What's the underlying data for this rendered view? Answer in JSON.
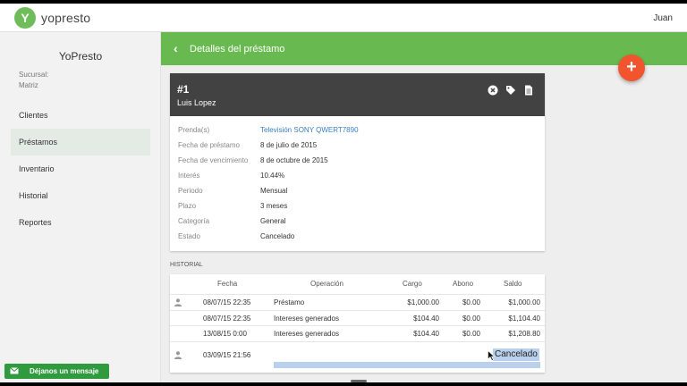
{
  "app": {
    "logo_glyph": "Y",
    "logo_text": "yopresto",
    "user": "Juan"
  },
  "sidebar": {
    "title": "YoPresto",
    "branch_label": "Sucursal:",
    "branch_value": "Matriz",
    "items": [
      {
        "label": "Clientes",
        "active": false
      },
      {
        "label": "Préstamos",
        "active": true
      },
      {
        "label": "Inventario",
        "active": false
      },
      {
        "label": "Historial",
        "active": false
      },
      {
        "label": "Reportes",
        "active": false
      }
    ]
  },
  "header": {
    "back_glyph": "‹",
    "title": "Detalles del préstamo",
    "accent_color": "#68b94f"
  },
  "fab": {
    "glyph": "+",
    "color": "#f2542d"
  },
  "loan": {
    "number": "#1",
    "client": "Luis Lopez",
    "actions": [
      "close-circle-icon",
      "tag-icon",
      "document-icon"
    ],
    "details": [
      {
        "label": "Prenda(s)",
        "value": "Televisión SONY QWERT7890",
        "link": true
      },
      {
        "label": "Fecha de préstamo",
        "value": "8 de julio de 2015",
        "link": false
      },
      {
        "label": "Fecha de vencimiento",
        "value": "8 de octubre de 2015",
        "link": false
      },
      {
        "label": "Interés",
        "value": "10.44%",
        "link": false
      },
      {
        "label": "Periodo",
        "value": "Mensual",
        "link": false
      },
      {
        "label": "Plazo",
        "value": "3 meses",
        "link": false
      },
      {
        "label": "Categoría",
        "value": "General",
        "link": false
      },
      {
        "label": "Estado",
        "value": "Cancelado",
        "link": false
      }
    ]
  },
  "history": {
    "section_label": "HISTORIAL",
    "columns": {
      "fecha": "Fecha",
      "operacion": "Operación",
      "cargo": "Cargo",
      "abono": "Abono",
      "saldo": "Saldo"
    },
    "rows": [
      {
        "user_icon": true,
        "fecha": "08/07/15 22:35",
        "operacion": "Préstamo",
        "cargo": "$1,000.00",
        "abono": "$0.00",
        "saldo": "$1,000.00"
      },
      {
        "user_icon": false,
        "fecha": "08/07/15 22:35",
        "operacion": "Intereses generados",
        "cargo": "$104.40",
        "abono": "$0.00",
        "saldo": "$1,104.40"
      },
      {
        "user_icon": false,
        "fecha": "13/08/15 0:00",
        "operacion": "Intereses generados",
        "cargo": "$104.40",
        "abono": "$0.00",
        "saldo": "$1,208.80"
      }
    ],
    "last_row": {
      "fecha": "03/09/15 21:56",
      "status": "Cancelado"
    }
  },
  "chat": {
    "label": "Déjanos un mensaje",
    "icon": "mail-icon"
  }
}
